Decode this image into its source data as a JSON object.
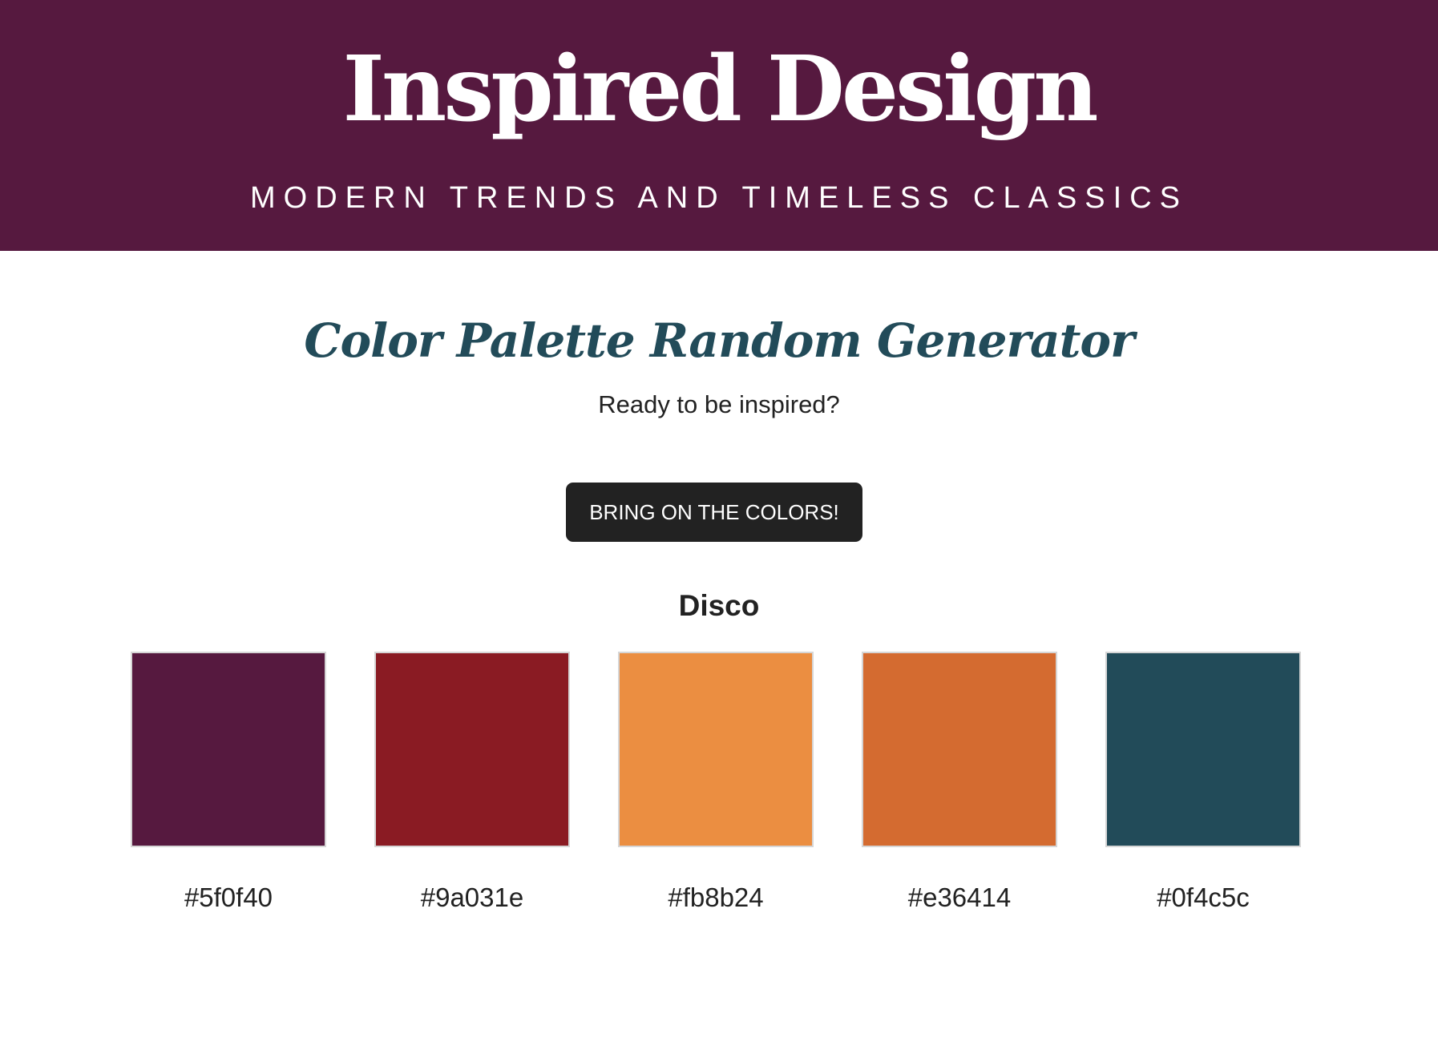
{
  "header": {
    "title": "Inspired Design",
    "tagline": "MODERN TRENDS AND TIMELESS CLASSICS",
    "background_color": "#56193f"
  },
  "main": {
    "title": "Color Palette Random Generator",
    "title_color": "#224b59",
    "intro": "Ready to be inspired?",
    "button_label": "BRING ON THE COLORS!",
    "palette": {
      "name": "Disco",
      "colors": [
        {
          "hex_label": "#5f0f40",
          "fill": "#56193f"
        },
        {
          "hex_label": "#9a031e",
          "fill": "#8a1b23"
        },
        {
          "hex_label": "#fb8b24",
          "fill": "#eb8e41"
        },
        {
          "hex_label": "#e36414",
          "fill": "#d46b30"
        },
        {
          "hex_label": "#0f4c5c",
          "fill": "#224b59"
        }
      ]
    }
  }
}
